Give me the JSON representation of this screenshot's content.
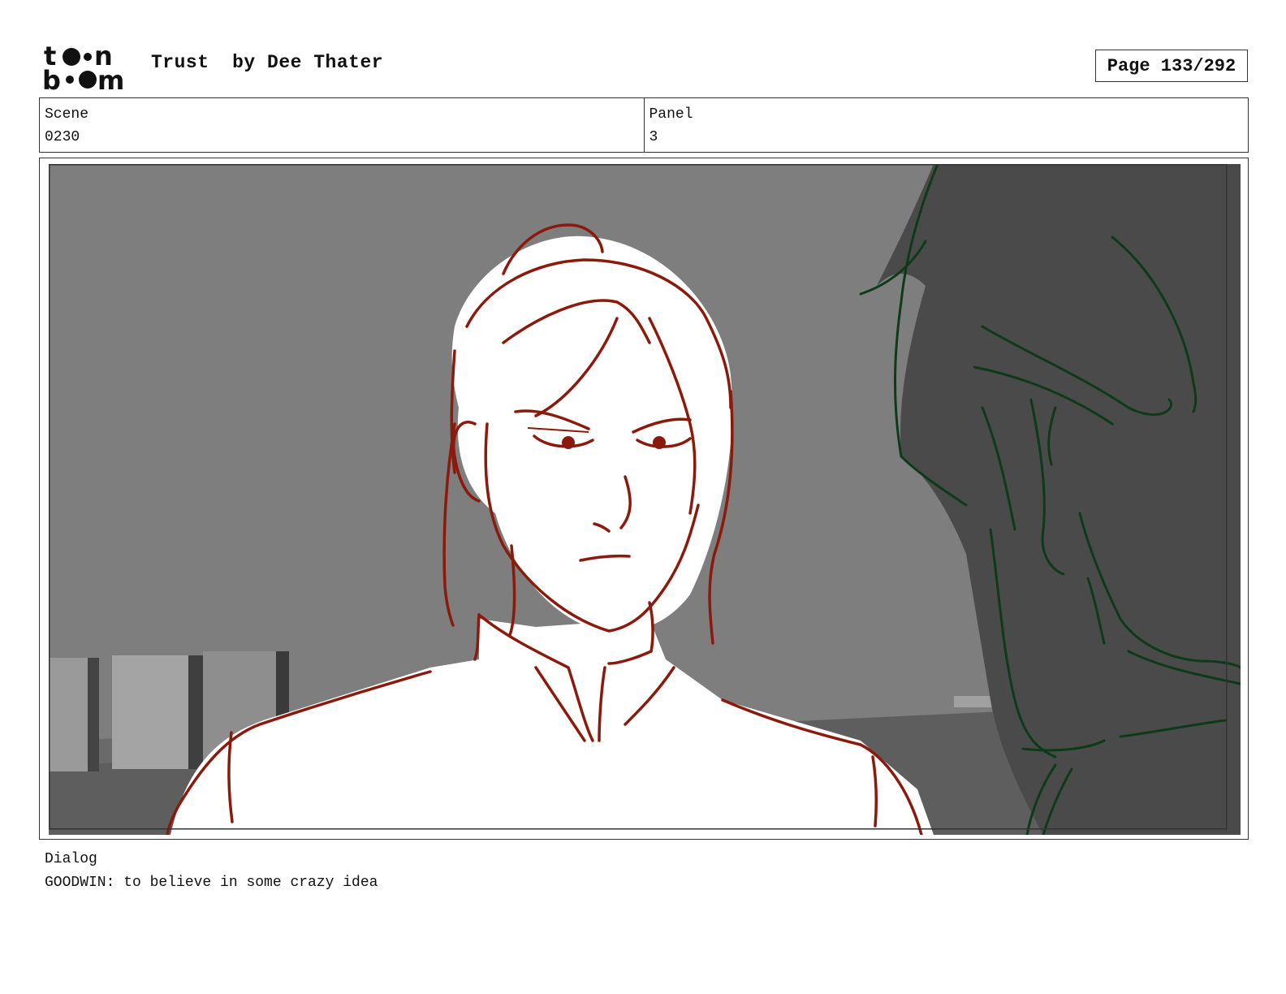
{
  "header": {
    "logo_text": "toon boom",
    "project_title": "Trust",
    "author": "by Dee Thater",
    "page": "Page 133/292"
  },
  "info": {
    "scene_label": "Scene",
    "scene_value": "0230",
    "panel_label": "Panel",
    "panel_value": "3"
  },
  "panel_image": {
    "description": "storyboard sketch",
    "line_colors": {
      "character": "#8b1a0c",
      "foreground_figure": "#0f3a1a"
    },
    "background_color": "#7d7d7d"
  },
  "dialog": {
    "label": "Dialog",
    "text": "GOODWIN: to believe in some crazy idea"
  }
}
